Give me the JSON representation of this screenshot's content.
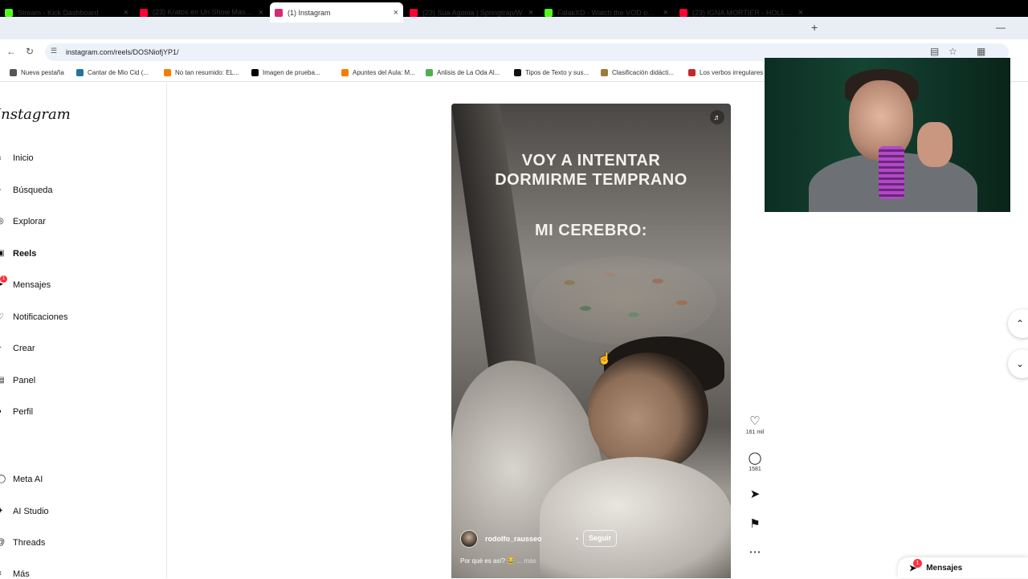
{
  "browser": {
    "tabs": [
      {
        "title": "Stream - Kick Dashboard",
        "favicon_color": "#53fc18"
      },
      {
        "title": "(23) Kratos en Un Show Mas 👀",
        "favicon_color": "#ff0033"
      },
      {
        "title": "(1) Instagram",
        "favicon_color": "#d62976",
        "active": true
      },
      {
        "title": "(23) Sua Agonia | Springtrap/W",
        "favicon_color": "#ff0033"
      },
      {
        "title": "FalakXD - Watch the VOD on K",
        "favicon_color": "#53fc18"
      },
      {
        "title": "(23) IGNA MORTIER - HOLLOW",
        "favicon_color": "#ff0033"
      }
    ],
    "new_tab": "+",
    "url": "instagram.com/reels/DOSNiofjYP1/",
    "bookmarks": [
      {
        "label": "Nueva pestaña",
        "color": "#555"
      },
      {
        "label": "Cantar de Mio Cid (...",
        "color": "#21759b"
      },
      {
        "label": "No tan resumido: EL...",
        "color": "#f57c00"
      },
      {
        "label": "Imagen de prueba...",
        "color": "#000"
      },
      {
        "label": "Apuntes del Aula: M...",
        "color": "#f57c00"
      },
      {
        "label": "Anlisis de La Oda Al...",
        "color": "#4caf50"
      },
      {
        "label": "Tipos de Texto y sus...",
        "color": "#111"
      },
      {
        "label": "Clasificación didácti...",
        "color": "#9c7a3c"
      },
      {
        "label": "Los verbos irregulares",
        "color": "#c62828"
      }
    ]
  },
  "sidebar": {
    "logo": "Instagram",
    "items": [
      {
        "label": "Inicio",
        "icon": "home-icon",
        "glyph": "⌂"
      },
      {
        "label": "Búsqueda",
        "icon": "search-icon",
        "glyph": "⌕"
      },
      {
        "label": "Explorar",
        "icon": "compass-icon",
        "glyph": "◎"
      },
      {
        "label": "Reels",
        "icon": "reels-icon",
        "glyph": "▣",
        "bold": true
      },
      {
        "label": "Mensajes",
        "icon": "messages-icon",
        "glyph": "➤",
        "badge": "1"
      },
      {
        "label": "Notificaciones",
        "icon": "heart-icon",
        "glyph": "♡"
      },
      {
        "label": "Crear",
        "icon": "plus-icon",
        "glyph": "+"
      },
      {
        "label": "Panel",
        "icon": "dashboard-icon",
        "glyph": "▤"
      },
      {
        "label": "Perfil",
        "icon": "profile-icon",
        "glyph": "●"
      }
    ],
    "extra": [
      {
        "label": "Meta AI",
        "icon": "meta-ai-icon",
        "glyph": "◯"
      },
      {
        "label": "AI Studio",
        "icon": "ai-studio-icon",
        "glyph": "✦"
      },
      {
        "label": "Threads",
        "icon": "threads-icon",
        "glyph": "@"
      },
      {
        "label": "Más",
        "icon": "menu-icon",
        "glyph": "≡"
      }
    ]
  },
  "reel": {
    "overlay_line1": "VOY A INTENTAR",
    "overlay_line2": "DORMIRME TEMPRANO",
    "overlay_line3": "MI CEREBRO:",
    "author": "rodolfo_rausseo",
    "dot": "•",
    "follow": "Seguir",
    "caption": "Por qué es así? 😂",
    "caption_more": "... más"
  },
  "actions": {
    "likes": "161 mil",
    "comments": "1581"
  },
  "messages_pill": {
    "label": "Mensajes",
    "badge": "1"
  }
}
